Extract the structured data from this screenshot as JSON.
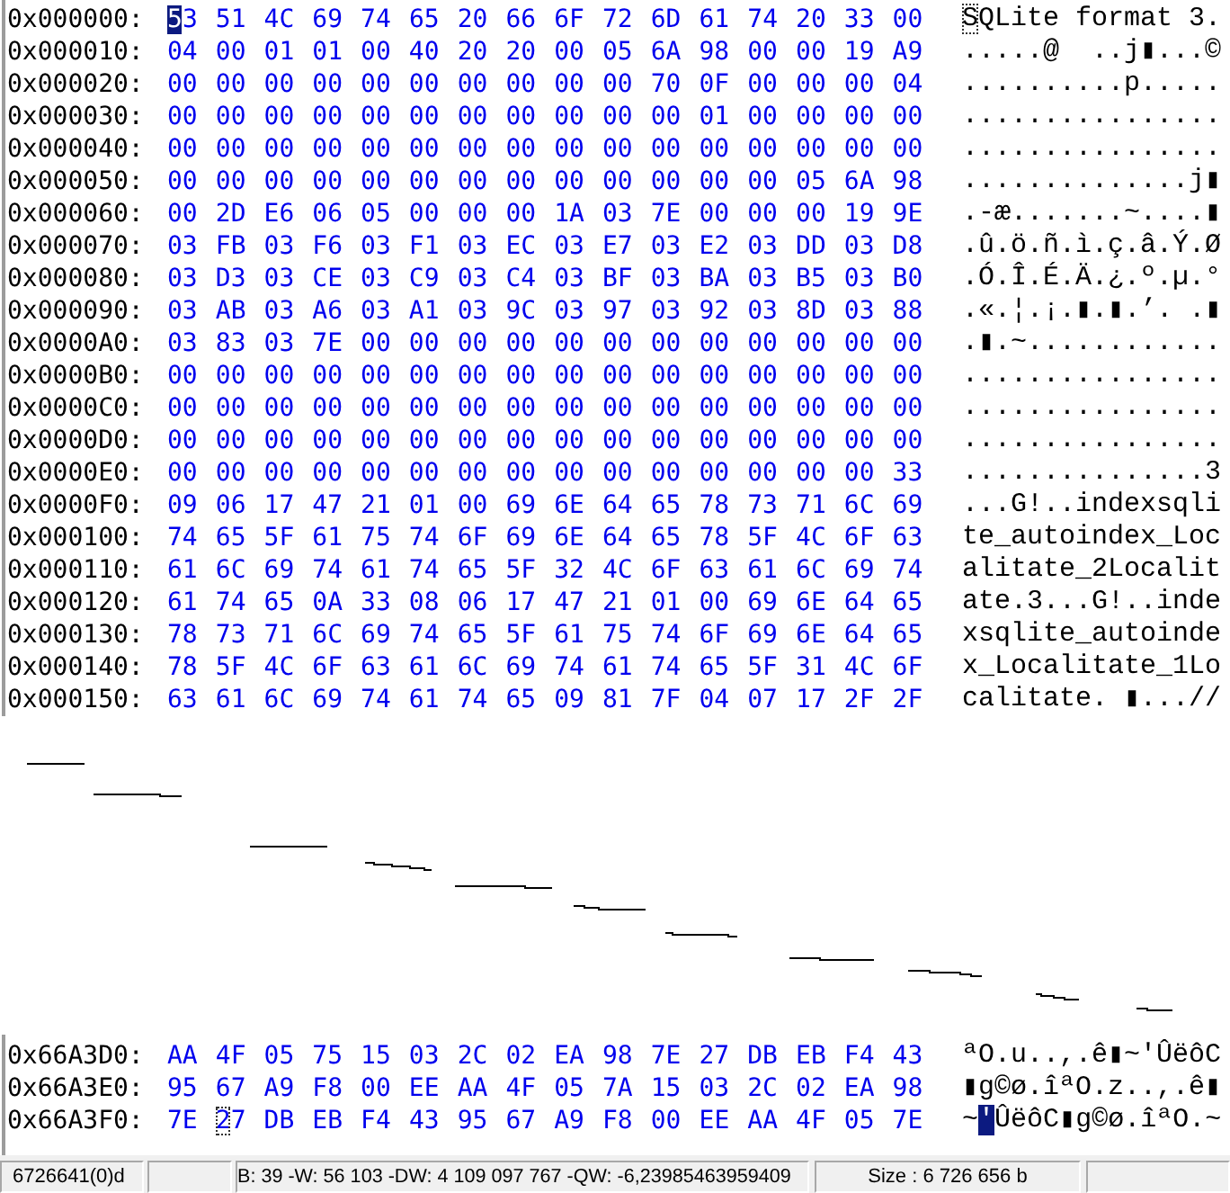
{
  "views": [
    {
      "rows": [
        {
          "address": "0x000000:",
          "hex": [
            {
              "kind": "cursor",
              "text": "5"
            },
            {
              "kind": "plain",
              "text": "3 51 4C 69 74 65 20 66 6F 72 6D 61 74 20 33 00"
            }
          ],
          "ascii": [
            {
              "kind": "caret",
              "text": "S"
            },
            {
              "kind": "plain",
              "text": "QLite format 3."
            }
          ]
        },
        {
          "address": "0x000010:",
          "hex": [
            {
              "kind": "plain",
              "text": "04 00 01 01 00 40 20 20 00 05 6A 98 00 00 19 A9"
            }
          ],
          "ascii": [
            {
              "kind": "plain",
              "text": ".....@  ..j▮...©"
            }
          ]
        },
        {
          "address": "0x000020:",
          "hex": [
            {
              "kind": "plain",
              "text": "00 00 00 00 00 00 00 00 00 00 70 0F 00 00 00 04"
            }
          ],
          "ascii": [
            {
              "kind": "plain",
              "text": "..........p....."
            }
          ]
        },
        {
          "address": "0x000030:",
          "hex": [
            {
              "kind": "plain",
              "text": "00 00 00 00 00 00 00 00 00 00 00 01 00 00 00 00"
            }
          ],
          "ascii": [
            {
              "kind": "plain",
              "text": "................"
            }
          ]
        },
        {
          "address": "0x000040:",
          "hex": [
            {
              "kind": "plain",
              "text": "00 00 00 00 00 00 00 00 00 00 00 00 00 00 00 00"
            }
          ],
          "ascii": [
            {
              "kind": "plain",
              "text": "................"
            }
          ]
        },
        {
          "address": "0x000050:",
          "hex": [
            {
              "kind": "plain",
              "text": "00 00 00 00 00 00 00 00 00 00 00 00 00 05 6A 98"
            }
          ],
          "ascii": [
            {
              "kind": "plain",
              "text": "..............j▮"
            }
          ]
        },
        {
          "address": "0x000060:",
          "hex": [
            {
              "kind": "plain",
              "text": "00 2D E6 06 05 00 00 00 1A 03 7E 00 00 00 19 9E"
            }
          ],
          "ascii": [
            {
              "kind": "plain",
              "text": ".-æ.......~....▮"
            }
          ]
        },
        {
          "address": "0x000070:",
          "hex": [
            {
              "kind": "plain",
              "text": "03 FB 03 F6 03 F1 03 EC 03 E7 03 E2 03 DD 03 D8"
            }
          ],
          "ascii": [
            {
              "kind": "plain",
              "text": ".û.ö.ñ.ì.ç.â.Ý.Ø"
            }
          ]
        },
        {
          "address": "0x000080:",
          "hex": [
            {
              "kind": "plain",
              "text": "03 D3 03 CE 03 C9 03 C4 03 BF 03 BA 03 B5 03 B0"
            }
          ],
          "ascii": [
            {
              "kind": "plain",
              "text": ".Ó.Î.É.Ä.¿.º.µ.°"
            }
          ]
        },
        {
          "address": "0x000090:",
          "hex": [
            {
              "kind": "plain",
              "text": "03 AB 03 A6 03 A1 03 9C 03 97 03 92 03 8D 03 88"
            }
          ],
          "ascii": [
            {
              "kind": "plain",
              "text": ".«.¦.¡.▮.▮.’. .▮"
            }
          ]
        },
        {
          "address": "0x0000A0:",
          "hex": [
            {
              "kind": "plain",
              "text": "03 83 03 7E 00 00 00 00 00 00 00 00 00 00 00 00"
            }
          ],
          "ascii": [
            {
              "kind": "plain",
              "text": ".▮.~............"
            }
          ]
        },
        {
          "address": "0x0000B0:",
          "hex": [
            {
              "kind": "plain",
              "text": "00 00 00 00 00 00 00 00 00 00 00 00 00 00 00 00"
            }
          ],
          "ascii": [
            {
              "kind": "plain",
              "text": "................"
            }
          ]
        },
        {
          "address": "0x0000C0:",
          "hex": [
            {
              "kind": "plain",
              "text": "00 00 00 00 00 00 00 00 00 00 00 00 00 00 00 00"
            }
          ],
          "ascii": [
            {
              "kind": "plain",
              "text": "................"
            }
          ]
        },
        {
          "address": "0x0000D0:",
          "hex": [
            {
              "kind": "plain",
              "text": "00 00 00 00 00 00 00 00 00 00 00 00 00 00 00 00"
            }
          ],
          "ascii": [
            {
              "kind": "plain",
              "text": "................"
            }
          ]
        },
        {
          "address": "0x0000E0:",
          "hex": [
            {
              "kind": "plain",
              "text": "00 00 00 00 00 00 00 00 00 00 00 00 00 00 00 33"
            }
          ],
          "ascii": [
            {
              "kind": "plain",
              "text": "...............3"
            }
          ]
        },
        {
          "address": "0x0000F0:",
          "hex": [
            {
              "kind": "plain",
              "text": "09 06 17 47 21 01 00 69 6E 64 65 78 73 71 6C 69"
            }
          ],
          "ascii": [
            {
              "kind": "plain",
              "text": "...G!..indexsqli"
            }
          ]
        },
        {
          "address": "0x000100:",
          "hex": [
            {
              "kind": "plain",
              "text": "74 65 5F 61 75 74 6F 69 6E 64 65 78 5F 4C 6F 63"
            }
          ],
          "ascii": [
            {
              "kind": "plain",
              "text": "te_autoindex_Loc"
            }
          ]
        },
        {
          "address": "0x000110:",
          "hex": [
            {
              "kind": "plain",
              "text": "61 6C 69 74 61 74 65 5F 32 4C 6F 63 61 6C 69 74"
            }
          ],
          "ascii": [
            {
              "kind": "plain",
              "text": "alitate_2Localit"
            }
          ]
        },
        {
          "address": "0x000120:",
          "hex": [
            {
              "kind": "plain",
              "text": "61 74 65 0A 33 08 06 17 47 21 01 00 69 6E 64 65"
            }
          ],
          "ascii": [
            {
              "kind": "plain",
              "text": "ate.3...G!..inde"
            }
          ]
        },
        {
          "address": "0x000130:",
          "hex": [
            {
              "kind": "plain",
              "text": "78 73 71 6C 69 74 65 5F 61 75 74 6F 69 6E 64 65"
            }
          ],
          "ascii": [
            {
              "kind": "plain",
              "text": "xsqlite_autoinde"
            }
          ]
        },
        {
          "address": "0x000140:",
          "hex": [
            {
              "kind": "plain",
              "text": "78 5F 4C 6F 63 61 6C 69 74 61 74 65 5F 31 4C 6F"
            }
          ],
          "ascii": [
            {
              "kind": "plain",
              "text": "x_Localitate_1Lo"
            }
          ]
        },
        {
          "address": "0x000150:",
          "hex": [
            {
              "kind": "plain",
              "text": "63 61 6C 69 74 61 74 65 09 81 7F 04 07 17 2F 2F"
            }
          ],
          "ascii": [
            {
              "kind": "plain",
              "text": "calitate. ▮...//"
            }
          ]
        }
      ]
    },
    {
      "rows": [
        {
          "address": "0x66A3D0:",
          "hex": [
            {
              "kind": "plain",
              "text": "AA 4F 05 75 15 03 2C 02 EA 98 7E 27 DB EB F4 43"
            }
          ],
          "ascii": [
            {
              "kind": "plain",
              "text": "ªO.u..,.ê▮~'ÛëôC"
            }
          ]
        },
        {
          "address": "0x66A3E0:",
          "hex": [
            {
              "kind": "plain",
              "text": "95 67 A9 F8 00 EE AA 4F 05 7A 15 03 2C 02 EA 98"
            }
          ],
          "ascii": [
            {
              "kind": "plain",
              "text": "▮g©ø.îªO.z..,.ê▮"
            }
          ]
        },
        {
          "address": "0x66A3F0:",
          "hex": [
            {
              "kind": "plain",
              "text": "7E "
            },
            {
              "kind": "caret",
              "text": "2"
            },
            {
              "kind": "plain",
              "text": "7 DB EB F4 43 95 67 A9 F8 00 EE AA 4F 05 7E"
            }
          ],
          "ascii": [
            {
              "kind": "plain",
              "text": "~"
            },
            {
              "kind": "cursor",
              "text": "'"
            },
            {
              "kind": "plain",
              "text": "ÛëôC▮g©ø.îªO.~"
            }
          ]
        }
      ]
    }
  ],
  "status_bar": {
    "fields": [
      "6726641(0)d",
      "B: 39 -W: 56 103 -DW: 4 109 097 767 -QW: -6,23985463959409",
      "Size : 6 726 656 b"
    ]
  }
}
